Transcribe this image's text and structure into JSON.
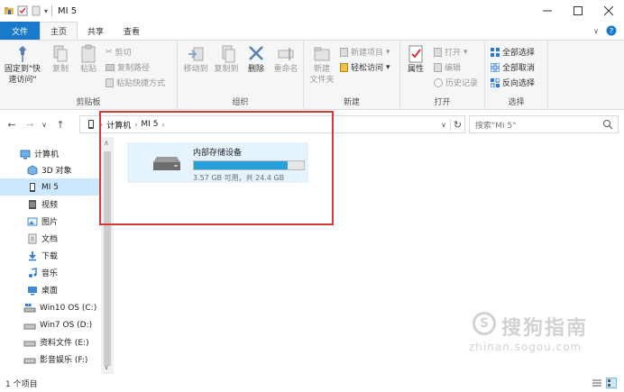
{
  "window": {
    "title": "MI 5",
    "controls": [
      "minimize-icon",
      "maximize-icon",
      "close-icon"
    ]
  },
  "tabs": [
    {
      "label": "文件"
    },
    {
      "label": "主页"
    },
    {
      "label": "共享"
    },
    {
      "label": "查看"
    }
  ],
  "ribbon": {
    "clipboard": {
      "label": "剪贴板",
      "pin": "固定到\"快速访问\"",
      "copy": "复制",
      "paste": "粘贴",
      "cut": "剪切",
      "copy_path": "复制路径",
      "paste_shortcut": "粘贴快捷方式"
    },
    "organize": {
      "label": "组织",
      "move_to": "移动到",
      "copy_to": "复制到",
      "delete": "删除",
      "rename": "重命名"
    },
    "new": {
      "label": "新建",
      "new_folder_line1": "新建",
      "new_folder_line2": "文件夹",
      "new_item": "新建项目",
      "easy_access": "轻松访问"
    },
    "open": {
      "label": "打开",
      "properties": "属性",
      "open": "打开",
      "edit": "编辑",
      "history": "历史记录"
    },
    "select": {
      "label": "选择",
      "select_all": "全部选择",
      "select_none": "全部取消",
      "invert": "反向选择"
    }
  },
  "address": {
    "crumbs": [
      "计算机",
      "MI 5"
    ],
    "search_placeholder": "搜索\"MI 5\""
  },
  "sidebar": {
    "items": [
      {
        "label": "计算机"
      },
      {
        "label": "3D 对象"
      },
      {
        "label": "MI 5"
      },
      {
        "label": "视频"
      },
      {
        "label": "图片"
      },
      {
        "label": "文档"
      },
      {
        "label": "下载"
      },
      {
        "label": "音乐"
      },
      {
        "label": "桌面"
      },
      {
        "label": "Win10 OS (C:)"
      },
      {
        "label": "Win7 OS (D:)"
      },
      {
        "label": "资料文件 (E:)"
      },
      {
        "label": "影音娱乐 (F:)"
      }
    ]
  },
  "content": {
    "drive": {
      "name": "内部存储设备",
      "info": "3.57 GB 可用，共 24.4 GB",
      "used_fraction": 0.854
    }
  },
  "watermark": {
    "logo_glyph": "S",
    "text": "搜狗指南",
    "url": "zhinan.sogou.com"
  },
  "status": {
    "items_count": "1 个项目"
  },
  "colors": {
    "accent": "#1979ca",
    "selection": "#cce8ff",
    "drive_fill": "#26a0da",
    "highlight_frame": "#d9383a"
  }
}
